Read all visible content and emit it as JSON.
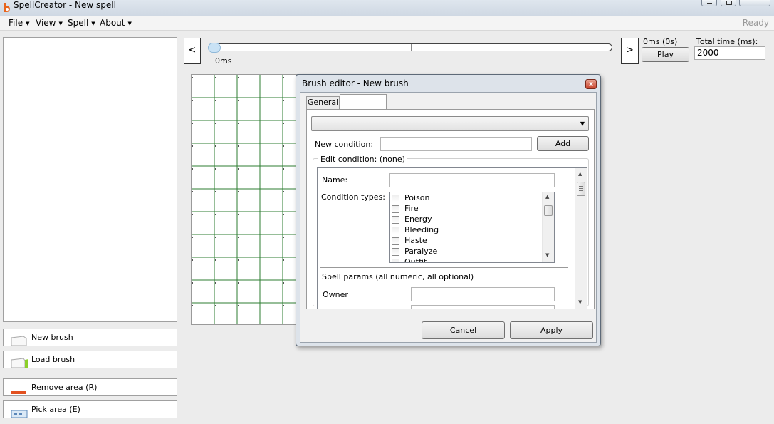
{
  "window": {
    "title": "SpellCreator - New spell"
  },
  "menu": [
    {
      "label": "File"
    },
    {
      "label": "View"
    },
    {
      "label": "Spell"
    },
    {
      "label": "About"
    }
  ],
  "status": {
    "text": "Ready"
  },
  "left_panel": {
    "buttons": [
      {
        "label": "New brush",
        "icon": "new-brush-icon"
      },
      {
        "label": "Load brush",
        "icon": "load-brush-icon"
      },
      {
        "label": "Remove area (R)",
        "icon": "remove-area-icon"
      },
      {
        "label": "Pick area (E)",
        "icon": "pick-area-icon"
      }
    ]
  },
  "timeline": {
    "prev_label": "<",
    "next_label": ">",
    "slider_value_label": "0ms",
    "slider_fraction": 0.0,
    "current_time": "0ms (0s)",
    "play_label": "Play",
    "total_time_label": "Total time (ms):",
    "total_time_value": "2000"
  },
  "grid": {
    "line_color": "#2e7d32"
  },
  "dialog": {
    "title": "Brush editor - New brush",
    "close_glyph": "x",
    "tabs": [
      {
        "label": "General"
      },
      {
        "label": ""
      }
    ],
    "new_condition_label": "New condition:",
    "add_label": "Add",
    "edit_condition_label": "Edit condition: (none)",
    "name_label": "Name:",
    "condition_types_label": "Condition types:",
    "condition_types": [
      "Poison",
      "Fire",
      "Energy",
      "Bleeding",
      "Haste",
      "Paralyze",
      "Outfit"
    ],
    "spell_params_label": "Spell params (all numeric, all optional)",
    "owner_label": "Owner",
    "cancel_label": "Cancel",
    "apply_label": "Apply"
  }
}
